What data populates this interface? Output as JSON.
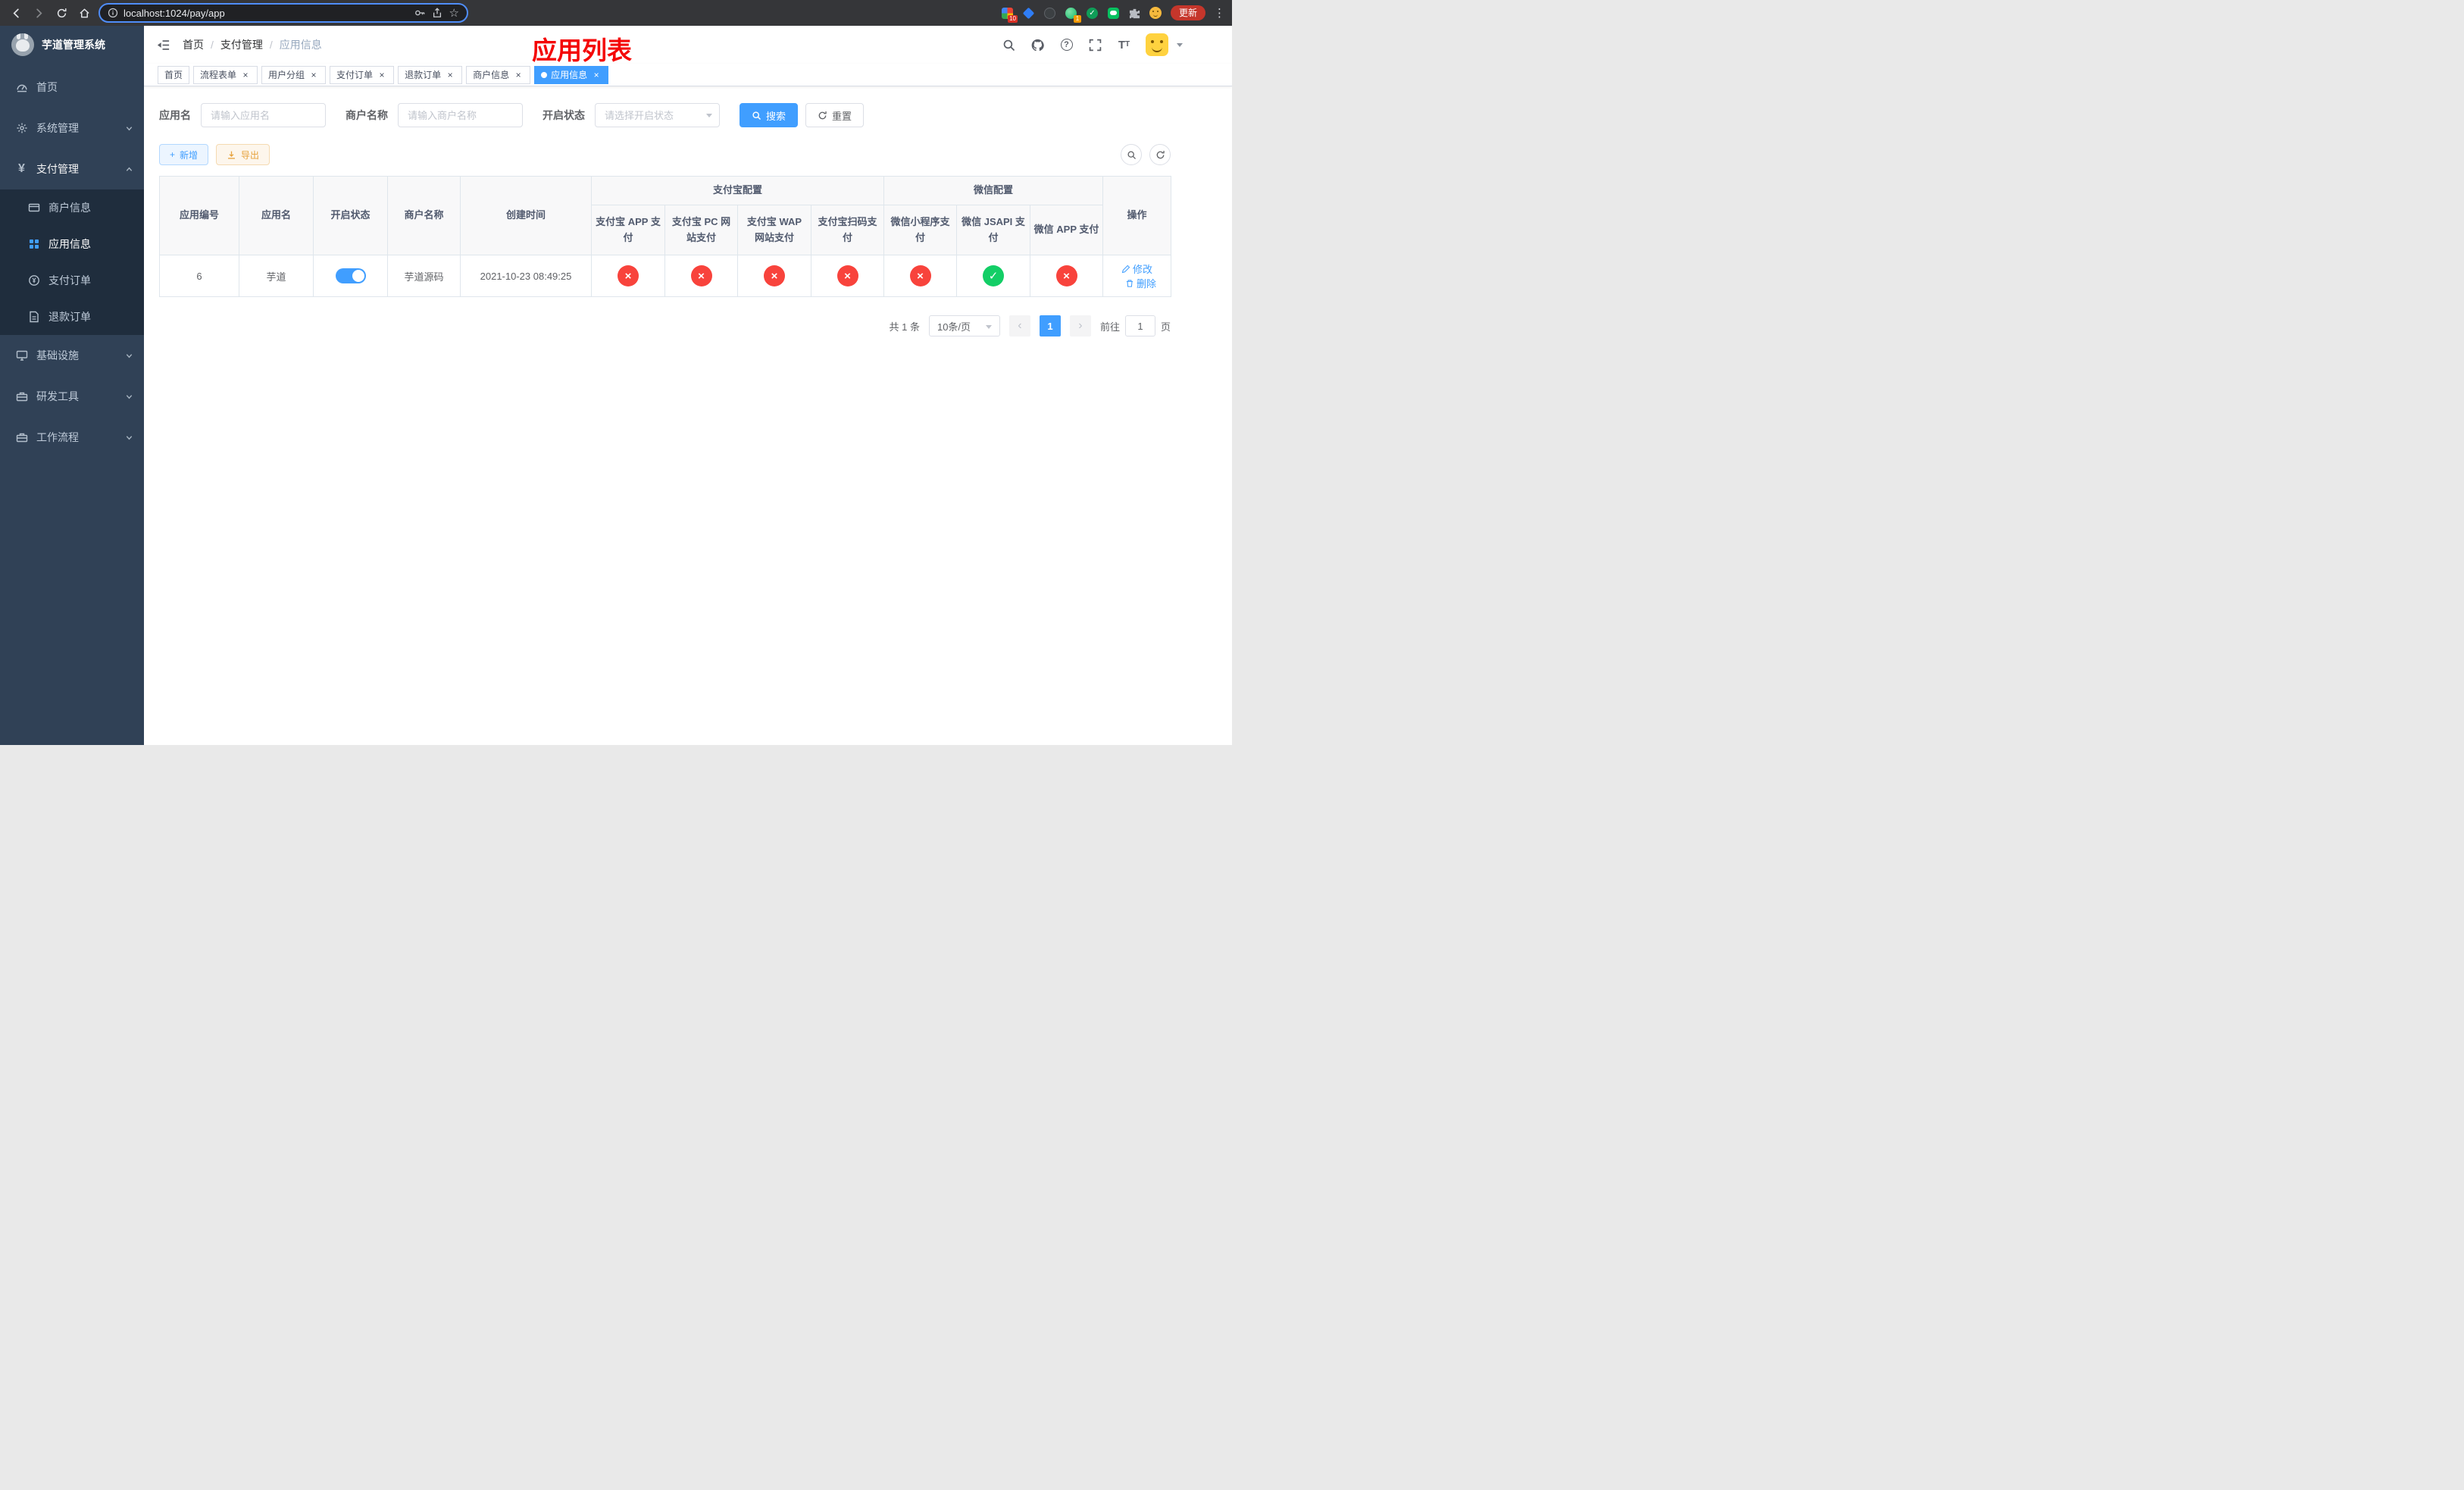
{
  "colors": {
    "primary": "#409EFF",
    "success_badge": "#13ce66",
    "danger_badge": "#f8433c",
    "sidebar_bg": "#304156",
    "submenu_bg": "#1f2d3d",
    "annotation_red": "#f40606"
  },
  "ui": {
    "close_glyph": "×",
    "prev_glyph": "‹",
    "next_glyph": "›",
    "breadcrumb_separator": "/",
    "yes_glyph": "✓",
    "no_glyph": "×",
    "plus_glyph": "+",
    "question_glyph": "?"
  },
  "browser": {
    "url": "localhost:1024/pay/app",
    "update_label": "更新",
    "extension_badge_count": "10",
    "avatar_badge_count": "1",
    "menu_glyph": "⋮",
    "star_glyph": "☆"
  },
  "header": {
    "logo_title": "芋道管理系统",
    "breadcrumb": [
      "首页",
      "支付管理",
      "应用信息"
    ],
    "annotation": "应用列表",
    "font_icon_big": "T",
    "font_icon_small": "T"
  },
  "sidebar": {
    "items": [
      {
        "label": "首页"
      },
      {
        "label": "系统管理"
      },
      {
        "label": "支付管理"
      },
      {
        "label": "商户信息"
      },
      {
        "label": "应用信息"
      },
      {
        "label": "支付订单"
      },
      {
        "label": "退款订单"
      },
      {
        "label": "基础设施"
      },
      {
        "label": "研发工具"
      },
      {
        "label": "工作流程"
      }
    ]
  },
  "tabs": [
    {
      "label": "首页"
    },
    {
      "label": "流程表单"
    },
    {
      "label": "用户分组"
    },
    {
      "label": "支付订单"
    },
    {
      "label": "退款订单"
    },
    {
      "label": "商户信息"
    },
    {
      "label": "应用信息"
    }
  ],
  "filters": {
    "app_name_label": "应用名",
    "app_name_placeholder": "请输入应用名",
    "merchant_label": "商户名称",
    "merchant_placeholder": "请输入商户名称",
    "status_label": "开启状态",
    "status_placeholder": "请选择开启状态",
    "search_button": "搜索",
    "reset_button": "重置"
  },
  "toolbar": {
    "add_button": "新增",
    "export_button": "导出"
  },
  "table": {
    "group_headers": {
      "alipay": "支付宝配置",
      "wechat": "微信配置"
    },
    "columns": {
      "id": "应用编号",
      "name": "应用名",
      "status": "开启状态",
      "merchant": "商户名称",
      "created": "创建时间",
      "alipay_app": "支付宝 APP 支付",
      "alipay_pc": "支付宝 PC 网站支付",
      "alipay_wap": "支付宝 WAP 网站支付",
      "alipay_qr": "支付宝扫码支付",
      "wx_mini": "微信小程序支付",
      "wx_jsapi": "微信 JSAPI 支付",
      "wx_app": "微信 APP 支付",
      "ops": "操作"
    },
    "row": {
      "id": "6",
      "name": "芋道",
      "enabled": true,
      "merchant": "芋道源码",
      "created": "2021-10-23 08:49:25",
      "channels": [
        false,
        false,
        false,
        false,
        false,
        true,
        false
      ],
      "edit_label": "修改",
      "delete_label": "删除"
    }
  },
  "pagination": {
    "total_text": "共 1 条",
    "page_size": "10条/页",
    "current_page": "1",
    "goto_prefix": "前往",
    "goto_value": "1",
    "goto_suffix": "页"
  }
}
